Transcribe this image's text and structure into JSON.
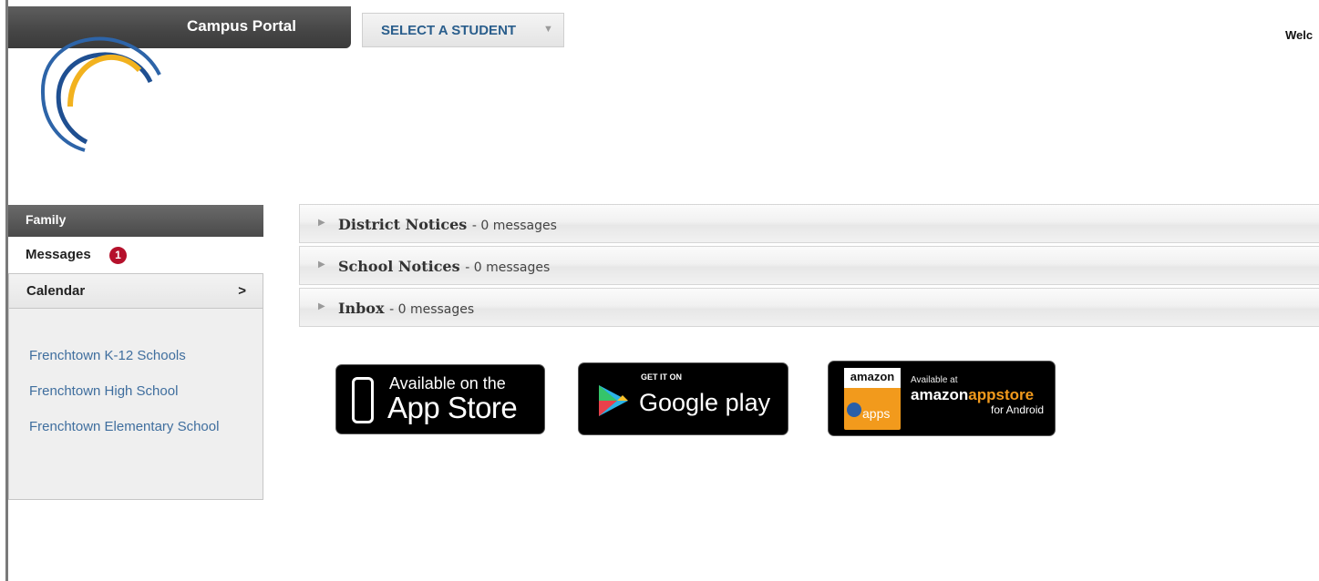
{
  "header": {
    "portal_title": "Campus Portal",
    "student_select_label": "SELECT A STUDENT",
    "welcome_text": "Welc"
  },
  "sidebar": {
    "section_title": "Family",
    "messages_label": "Messages",
    "messages_badge": "1",
    "calendar_label": "Calendar",
    "calendar_chevron": ">",
    "links": [
      "Frenchtown K-12 Schools",
      "Frenchtown High School",
      "Frenchtown Elementary School"
    ]
  },
  "notices": [
    {
      "title": "District Notices",
      "count": "- 0 messages"
    },
    {
      "title": "School Notices",
      "count": "- 0 messages"
    },
    {
      "title": "Inbox",
      "count": "- 0 messages"
    }
  ],
  "badges": {
    "appstore_small": "Available on the",
    "appstore_big": "App Store",
    "googleplay_small": "GET IT ON",
    "googleplay_big": "Google play",
    "amazon_tile_top": "amazon",
    "amazon_tile_apps": "apps",
    "amazon_available": "Available at",
    "amazon_name_1": "amazon",
    "amazon_name_2": "appstore",
    "amazon_android": "for Android"
  },
  "colors": {
    "link": "#3f6e9e",
    "badge": "#b5102b",
    "select_text": "#2a5e8c",
    "amazon_orange": "#f29a1c"
  }
}
